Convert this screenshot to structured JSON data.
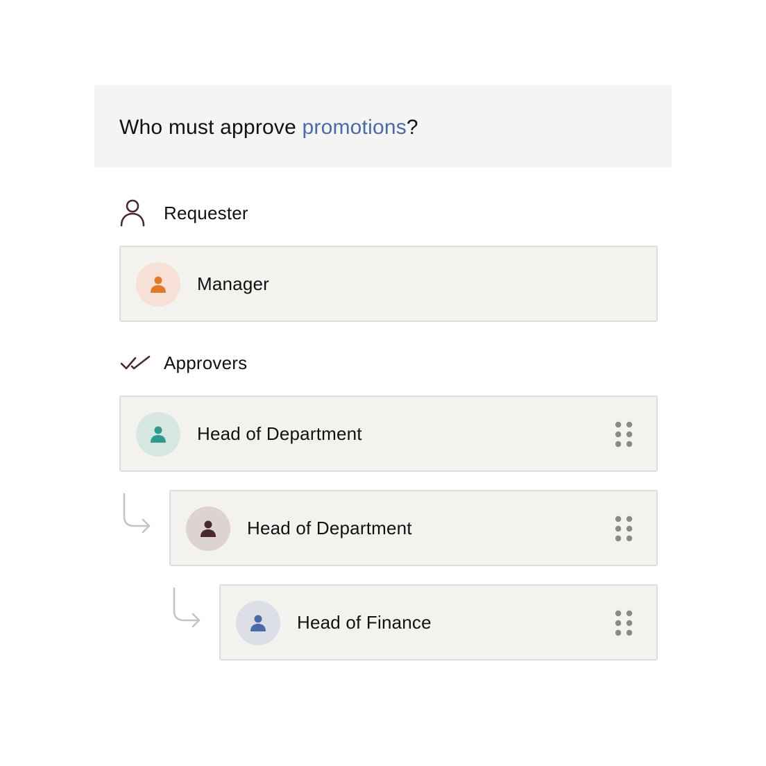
{
  "question": {
    "prefix": "Who must approve ",
    "highlight": "promotions",
    "suffix": "?"
  },
  "requester": {
    "heading": "Requester",
    "icon": "person-outline-icon",
    "items": [
      {
        "label": "Manager",
        "avatar_color": "#e07a2c",
        "avatar_bg": "#f7e1d6"
      }
    ]
  },
  "approvers": {
    "heading": "Approvers",
    "icon": "double-check-icon",
    "items": [
      {
        "label": "Head of Department",
        "avatar_color": "#2e9a8c",
        "avatar_bg": "#d6e7e2",
        "level": 0
      },
      {
        "label": "Head of Department",
        "avatar_color": "#4a2733",
        "avatar_bg": "#ddd4d2",
        "level": 1
      },
      {
        "label": "Head of Finance",
        "avatar_color": "#4a6aa8",
        "avatar_bg": "#dcdfe6",
        "level": 2
      }
    ]
  },
  "colors": {
    "accent": "#4a6aa8",
    "icon_dark": "#4a2733",
    "card_bg": "#f3f2ee",
    "panel_bg": "#f4f4f4",
    "handle": "#8a8a8a",
    "arrow": "#c4c4c4"
  }
}
